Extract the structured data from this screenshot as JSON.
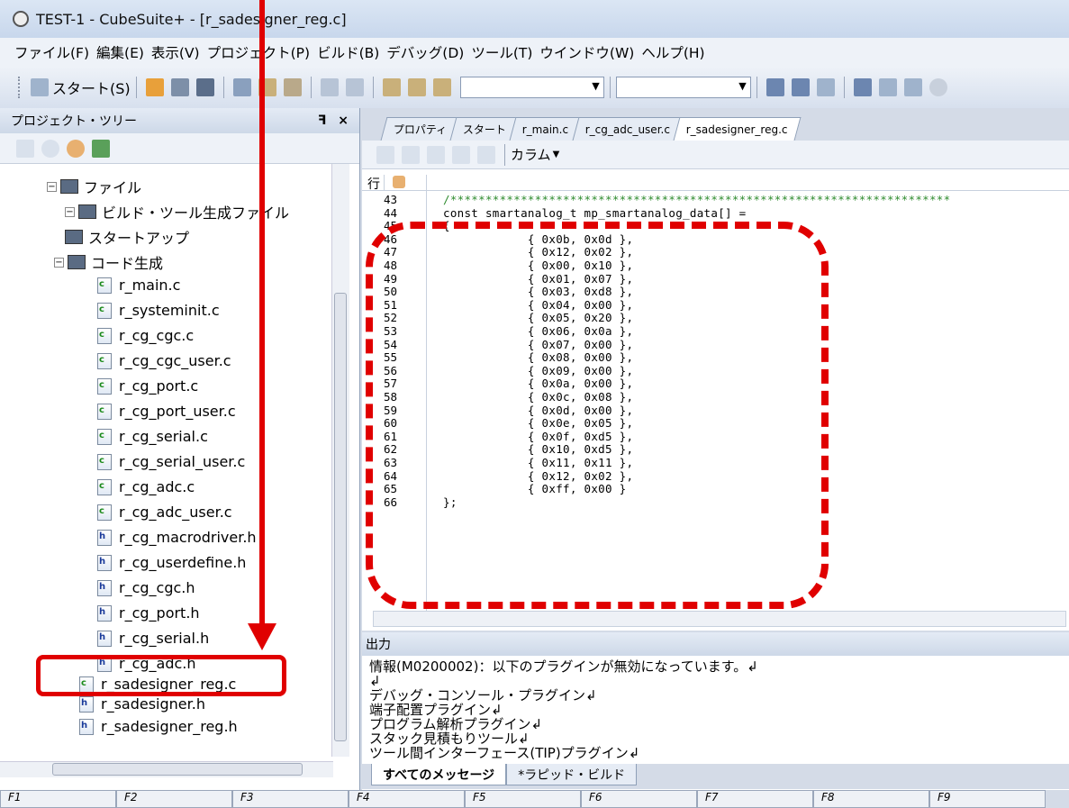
{
  "window": {
    "title": "TEST-1 - CubeSuite+ - [r_sadesigner_reg.c]"
  },
  "menu": [
    "ファイル(F)",
    "編集(E)",
    "表示(V)",
    "プロジェクト(P)",
    "ビルド(B)",
    "デバッグ(D)",
    "ツール(T)",
    "ウインドウ(W)",
    "ヘルプ(H)"
  ],
  "toolbar": {
    "start_label": "スタート(S)"
  },
  "project_tree": {
    "title": "プロジェクト・ツリー",
    "pin": "ꟻ",
    "close": "×",
    "items": [
      {
        "label": "ファイル",
        "kind": "folder"
      },
      {
        "label": "ビルド・ツール生成ファイル",
        "kind": "folder"
      },
      {
        "label": "スタートアップ",
        "kind": "folder"
      },
      {
        "label": "コード生成",
        "kind": "folder"
      },
      {
        "label": "r_main.c",
        "kind": "c"
      },
      {
        "label": "r_systeminit.c",
        "kind": "c"
      },
      {
        "label": "r_cg_cgc.c",
        "kind": "c"
      },
      {
        "label": "r_cg_cgc_user.c",
        "kind": "c"
      },
      {
        "label": "r_cg_port.c",
        "kind": "c"
      },
      {
        "label": "r_cg_port_user.c",
        "kind": "c"
      },
      {
        "label": "r_cg_serial.c",
        "kind": "c"
      },
      {
        "label": "r_cg_serial_user.c",
        "kind": "c"
      },
      {
        "label": "r_cg_adc.c",
        "kind": "c"
      },
      {
        "label": "r_cg_adc_user.c",
        "kind": "c"
      },
      {
        "label": "r_cg_macrodriver.h",
        "kind": "h"
      },
      {
        "label": "r_cg_userdefine.h",
        "kind": "h"
      },
      {
        "label": "r_cg_cgc.h",
        "kind": "h"
      },
      {
        "label": "r_cg_port.h",
        "kind": "h"
      },
      {
        "label": "r_cg_serial.h",
        "kind": "h"
      },
      {
        "label": "r_cg_adc.h",
        "kind": "h"
      },
      {
        "label": "r_sadesigner_reg.c",
        "kind": "c"
      },
      {
        "label": "r_sadesigner.h",
        "kind": "h"
      },
      {
        "label": "r_sadesigner_reg.h",
        "kind": "h"
      }
    ]
  },
  "editor": {
    "tabs": [
      "プロパティ",
      "スタート",
      "r_main.c",
      "r_cg_adc_user.c",
      "r_sadesigner_reg.c"
    ],
    "column_label": "カラム",
    "gutter_label": "行",
    "lines": [
      {
        "n": "43",
        "code": "/***********************************************************************"
      },
      {
        "n": "44",
        "code": "const smartanalog_t mp_smartanalog_data[] ="
      },
      {
        "n": "45",
        "code": "{"
      },
      {
        "n": "46",
        "code": "            { 0x0b, 0x0d },"
      },
      {
        "n": "47",
        "code": "            { 0x12, 0x02 },"
      },
      {
        "n": "48",
        "code": "            { 0x00, 0x10 },"
      },
      {
        "n": "49",
        "code": "            { 0x01, 0x07 },"
      },
      {
        "n": "50",
        "code": "            { 0x03, 0xd8 },"
      },
      {
        "n": "51",
        "code": "            { 0x04, 0x00 },"
      },
      {
        "n": "52",
        "code": "            { 0x05, 0x20 },"
      },
      {
        "n": "53",
        "code": "            { 0x06, 0x0a },"
      },
      {
        "n": "54",
        "code": "            { 0x07, 0x00 },"
      },
      {
        "n": "55",
        "code": "            { 0x08, 0x00 },"
      },
      {
        "n": "56",
        "code": "            { 0x09, 0x00 },"
      },
      {
        "n": "57",
        "code": "            { 0x0a, 0x00 },"
      },
      {
        "n": "58",
        "code": "            { 0x0c, 0x08 },"
      },
      {
        "n": "59",
        "code": "            { 0x0d, 0x00 },"
      },
      {
        "n": "60",
        "code": "            { 0x0e, 0x05 },"
      },
      {
        "n": "61",
        "code": "            { 0x0f, 0xd5 },"
      },
      {
        "n": "62",
        "code": "            { 0x10, 0xd5 },"
      },
      {
        "n": "63",
        "code": "            { 0x11, 0x11 },"
      },
      {
        "n": "64",
        "code": "            { 0x12, 0x02 },"
      },
      {
        "n": "65",
        "code": "            { 0xff, 0x00 }"
      },
      {
        "n": "66",
        "code": "};"
      }
    ]
  },
  "output": {
    "title": "出力",
    "lines": [
      "情報(M0200002)：以下のプラグインが無効になっています。↲",
      "↲",
      "デバッグ・コンソール・プラグイン↲",
      "端子配置プラグイン↲",
      "プログラム解析プラグイン↲",
      "スタック見積もりツール↲",
      "ツール間インターフェース(TIP)プラグイン↲"
    ],
    "tabs": [
      "すべてのメッセージ",
      "*ラピッド・ビルド"
    ]
  },
  "fkeys": [
    "F1",
    "F2",
    "F3",
    "F4",
    "F5",
    "F6",
    "F7",
    "F8",
    "F9"
  ],
  "colors": {
    "annotation": "#e00000",
    "keyword_comment": "#2e8b2e"
  }
}
